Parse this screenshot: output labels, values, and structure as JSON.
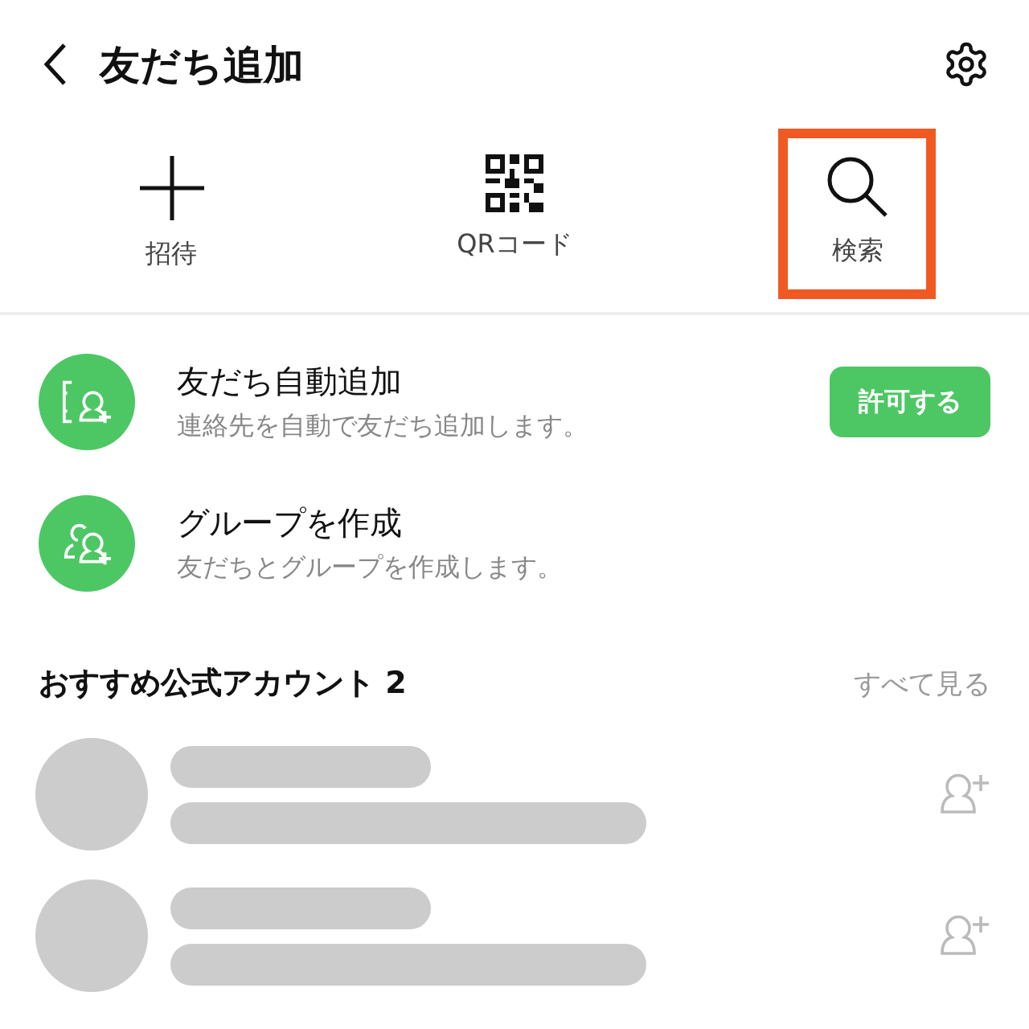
{
  "header": {
    "title": "友だち追加"
  },
  "actions": [
    {
      "kind": "invite",
      "label": "招待",
      "highlighted": false
    },
    {
      "kind": "qr",
      "label": "QRコード",
      "highlighted": false
    },
    {
      "kind": "search",
      "label": "検索",
      "highlighted": true
    }
  ],
  "features": [
    {
      "kind": "auto",
      "title": "友だち自動追加",
      "subtitle": "連絡先を自動で友だち追加します。",
      "button": "許可する"
    },
    {
      "kind": "group",
      "title": "グループを作成",
      "subtitle": "友だちとグループを作成します。"
    }
  ],
  "recommended": {
    "title": "おすすめ公式アカウント 2",
    "see_all": "すべて見る",
    "accounts": [
      {
        "kind": "placeholder"
      },
      {
        "kind": "placeholder"
      }
    ]
  }
}
